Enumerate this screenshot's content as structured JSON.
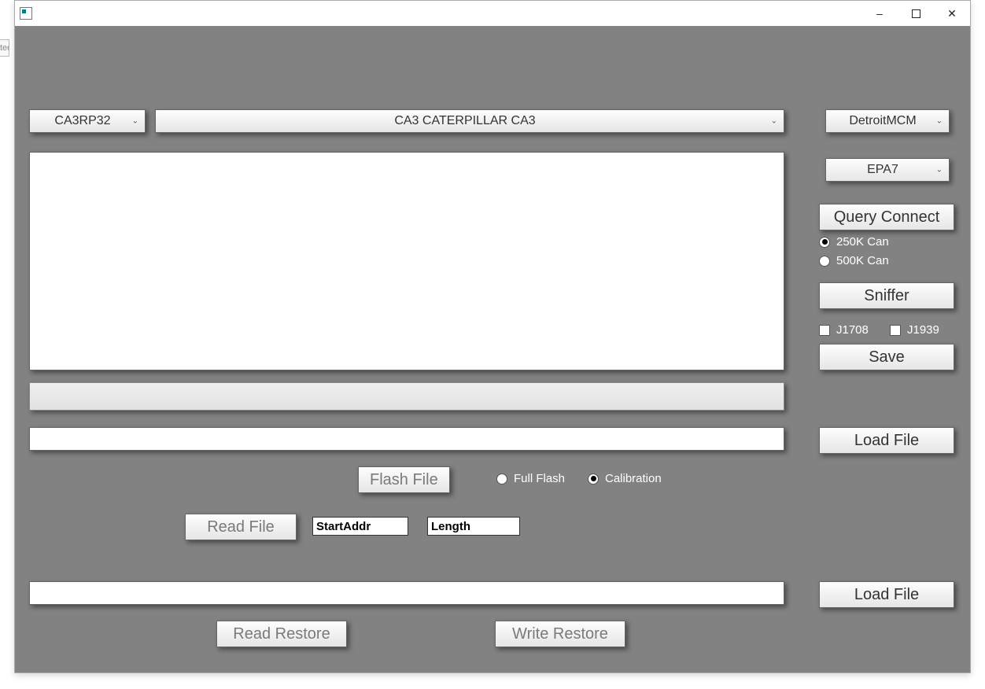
{
  "titlebar": {
    "minimize": "–",
    "maximize_icon": "▢",
    "close": "✕"
  },
  "top": {
    "adapter": "CA3RP32",
    "vehicle": "CA3 CATERPILLAR CA3"
  },
  "side": {
    "module": "DetroitMCM",
    "epa": "EPA7",
    "query_connect": "Query Connect",
    "can_250": "250K Can",
    "can_500": "500K Can",
    "can_selected": "250",
    "sniffer": "Sniffer",
    "j1708": "J1708",
    "j1939": "J1939",
    "save": "Save",
    "load_file_1": "Load File",
    "load_file_2": "Load File"
  },
  "flash": {
    "button": "Flash File",
    "full_flash": "Full Flash",
    "calibration": "Calibration",
    "selected": "calibration"
  },
  "read": {
    "button": "Read File",
    "start_addr_label": "StartAddr",
    "length_label": "Length"
  },
  "restore": {
    "read": "Read Restore",
    "write": "Write Restore"
  },
  "edge_text": "ted"
}
